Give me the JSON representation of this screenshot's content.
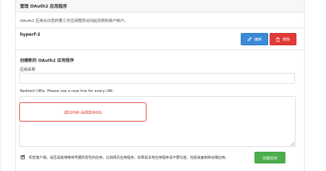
{
  "header": {
    "title": "管理 OAuth2 应用程序"
  },
  "description": "OAuth2 应用允许您的第三方应用程序访问此实例的用户帐户。",
  "app": {
    "name": "hyperf-2",
    "edit_label": "编辑",
    "delete_label": "删除"
  },
  "create_form": {
    "section_title": "创建新的 OAuth2 应用程序",
    "name_label": "应用名称",
    "name_value": "",
    "redirect_label": "Redirect URIs. Please use a new line for every URI.",
    "redirect_value": "",
    "annotation_text": "drone-address",
    "confidential_label": "机密客户端。是否是能够维持凭据机密性的应用，比如网页应用程序。如果是本地应用程序请不要勾选，包括桌面和移动端应用。",
    "confidential_checked": true,
    "submit_label": "创建应用"
  },
  "colors": {
    "edit": "#3b8ad6",
    "delete": "#e23a37",
    "create": "#4cae4c",
    "annotation": "#e0483f"
  }
}
